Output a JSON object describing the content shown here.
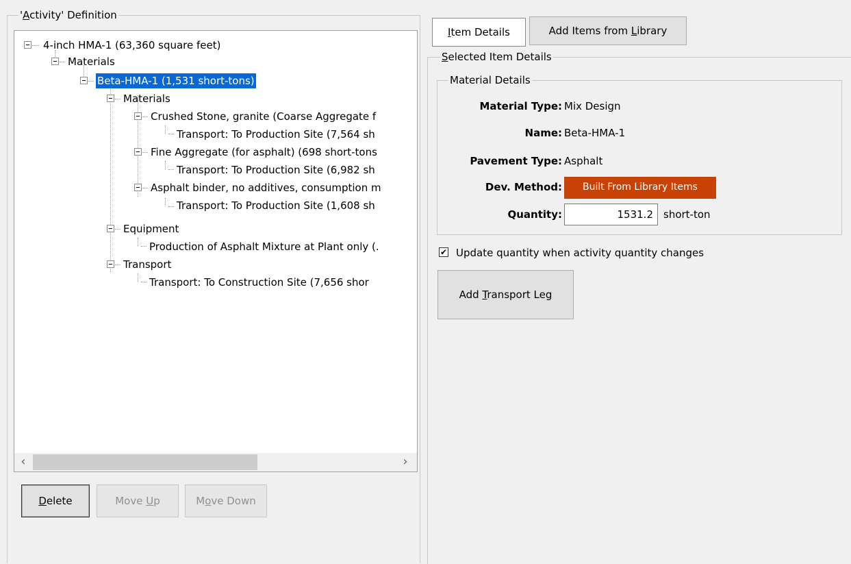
{
  "activity_group": {
    "title": "'Activity' Definition"
  },
  "tree": {
    "nodes": [
      {
        "label": "4-inch HMA-1 (63,360 square feet)"
      },
      {
        "label": "Materials"
      },
      {
        "label": "Beta-HMA-1 (1,531 short-tons)"
      },
      {
        "label": "Materials"
      },
      {
        "label": "Crushed Stone, granite (Coarse Aggregate f"
      },
      {
        "label": "Transport: To Production Site (7,564 sh"
      },
      {
        "label": "Fine Aggregate (for asphalt) (698 short-tons"
      },
      {
        "label": "Transport: To Production Site (6,982 sh"
      },
      {
        "label": "Asphalt binder, no additives, consumption m"
      },
      {
        "label": "Transport: To Production Site (1,608 sh"
      },
      {
        "label": "Equipment"
      },
      {
        "label": "Production of Asphalt Mixture at Plant only (."
      },
      {
        "label": "Transport"
      },
      {
        "label": "Transport: To Construction Site (7,656 shor"
      }
    ],
    "selected_index": 2
  },
  "scrollbar": {
    "left_arrow": "‹",
    "right_arrow": "›"
  },
  "buttons": {
    "delete_pre": "",
    "delete_key": "D",
    "delete_post": "elete",
    "move_up_pre": "Move ",
    "move_up_key": "U",
    "move_up_post": "p",
    "move_down_pre": "M",
    "move_down_key": "o",
    "move_down_post": "ve Down"
  },
  "tabs": {
    "item_details_key": "I",
    "item_details_post": "tem Details",
    "library_pre": "Add Items from ",
    "library_key": "L",
    "library_post": "ibrary"
  },
  "selected_details": {
    "title_key": "S",
    "title_post": "elected Item Details",
    "material_details_title": "Material Details",
    "fields": {
      "material_type_label": "Material Type:",
      "material_type_value": "Mix Design",
      "name_label": "Name:",
      "name_value": "Beta-HMA-1",
      "pavement_type_label": "Pavement Type:",
      "pavement_type_value": "Asphalt",
      "dev_method_label": "Dev. Method:",
      "dev_method_value": "Built From Library Items",
      "quantity_label": "Quantity:",
      "quantity_value": "1531.2",
      "quantity_unit": "short-ton"
    },
    "update_checkbox": {
      "checked": true,
      "label": "Update quantity when activity quantity changes"
    },
    "transport_btn_pre": "Add ",
    "transport_btn_key": "T",
    "transport_btn_post": "ransport Leg"
  },
  "colors": {
    "selection": "#0a68d6",
    "dev_method_bg": "#c84205"
  }
}
